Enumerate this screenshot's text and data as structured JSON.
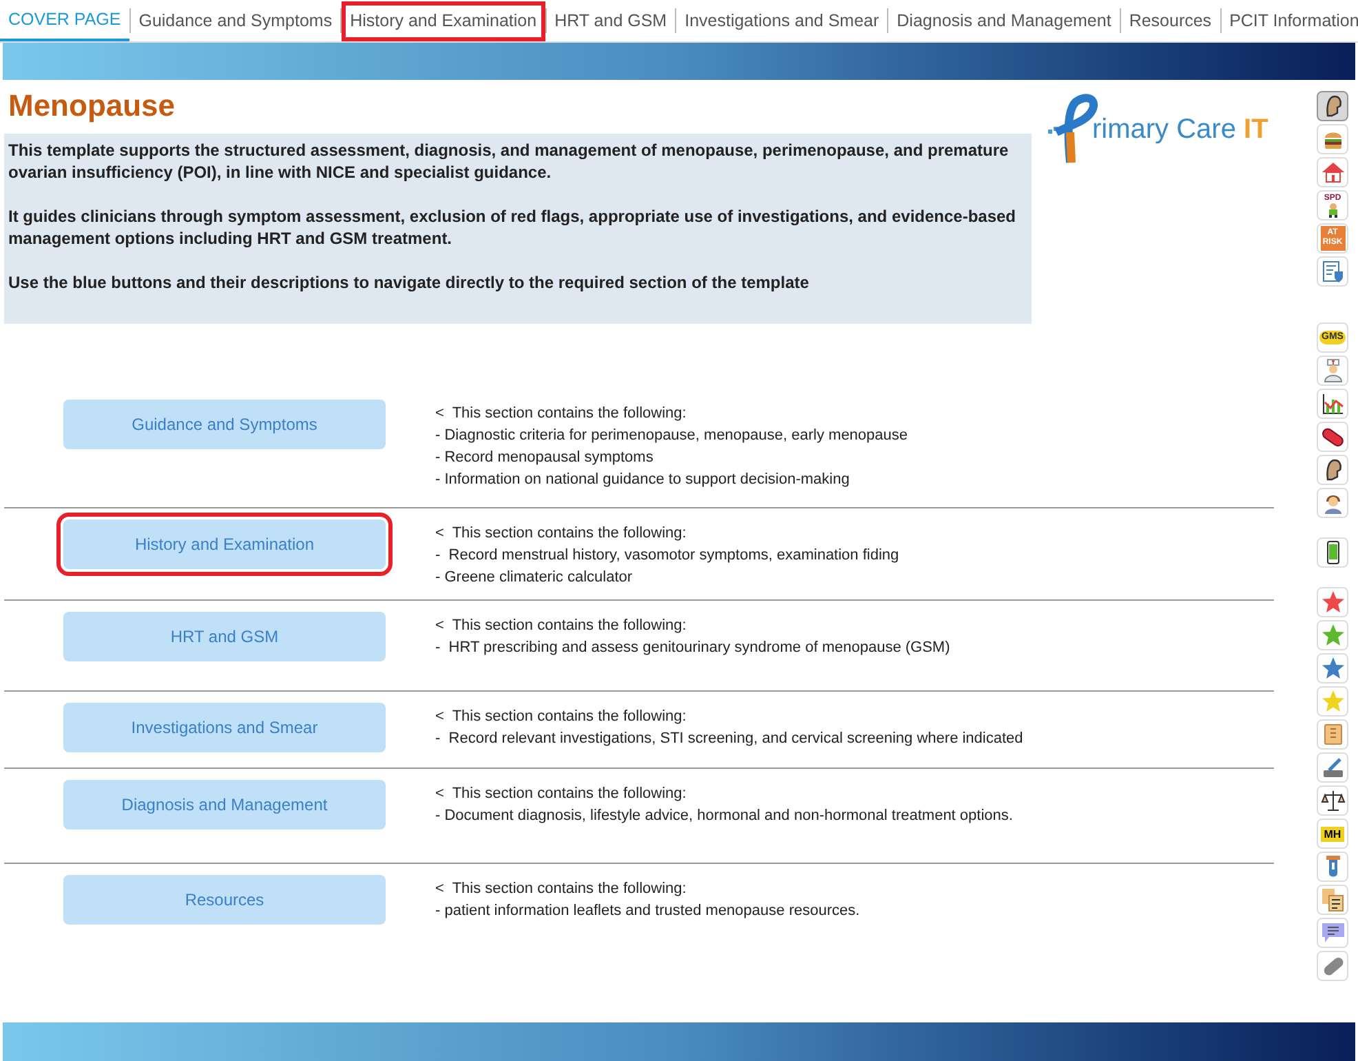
{
  "tabs": [
    {
      "label": "COVER PAGE",
      "selected": true,
      "highlighted": false
    },
    {
      "label": "Guidance and Symptoms",
      "selected": false,
      "highlighted": false
    },
    {
      "label": "History and Examination",
      "selected": false,
      "highlighted": true
    },
    {
      "label": "HRT and GSM",
      "selected": false,
      "highlighted": false
    },
    {
      "label": "Investigations and Smear",
      "selected": false,
      "highlighted": false
    },
    {
      "label": "Diagnosis and Management",
      "selected": false,
      "highlighted": false
    },
    {
      "label": "Resources",
      "selected": false,
      "highlighted": false
    },
    {
      "label": "PCIT Information",
      "selected": false,
      "highlighted": false
    }
  ],
  "title": "Menopause",
  "logo": {
    "text": "rimary Care",
    "accent": "IT"
  },
  "intro": [
    "This template supports the structured assessment, diagnosis, and management of menopause, perimenopause, and premature ovarian insufficiency (POI), in line with NICE and specialist guidance.",
    "It guides clinicians through symptom assessment, exclusion of red flags, appropriate use of investigations, and evidence-based management options including HRT and GSM treatment.",
    "Use the blue buttons and their descriptions to navigate directly to the required section of the template"
  ],
  "sections": [
    {
      "button": "Guidance and Symptoms",
      "highlighted": false,
      "lines": [
        "<  This section contains the following:",
        "- Diagnostic criteria for perimenopause, menopause, early menopause",
        "- Record menopausal symptoms",
        "- Information on national guidance to support decision-making"
      ]
    },
    {
      "button": "History and Examination",
      "highlighted": true,
      "lines": [
        "<  This section contains the following:",
        "-  Record menstrual history, vasomotor symptoms, examination fiding",
        "- Greene climateric calculator"
      ]
    },
    {
      "button": "HRT and GSM",
      "highlighted": false,
      "lines": [
        "<  This section contains the following:",
        "-  HRT prescribing and assess genitourinary syndrome of menopause (GSM)"
      ]
    },
    {
      "button": "Investigations and Smear",
      "highlighted": false,
      "lines": [
        "<  This section contains the following:",
        "-  Record relevant investigations, STI screening, and cervical screening where indicated"
      ]
    },
    {
      "button": "Diagnosis and Management",
      "highlighted": false,
      "lines": [
        "<  This section contains the following:",
        "- Document diagnosis, lifestyle advice, hormonal and non-hormonal treatment options."
      ]
    },
    {
      "button": "Resources",
      "highlighted": false,
      "lines": [
        "<  This section contains the following:",
        "- patient information leaflets and trusted menopause resources."
      ]
    }
  ],
  "toolbar_groups": [
    {
      "buttons": [
        {
          "kind": "head",
          "selected": true
        },
        {
          "kind": "burger",
          "selected": false
        },
        {
          "kind": "house",
          "selected": false
        },
        {
          "kind": "figure",
          "label": "SPD",
          "selected": false
        },
        {
          "kind": "risk",
          "label": "AT RISK",
          "selected": false
        },
        {
          "kind": "document",
          "selected": false
        }
      ]
    },
    {
      "buttons": [
        {
          "kind": "gms",
          "label": "GMS",
          "selected": false
        },
        {
          "kind": "nurse",
          "selected": false
        },
        {
          "kind": "chart",
          "selected": false
        },
        {
          "kind": "pill",
          "selected": false
        },
        {
          "kind": "head",
          "selected": false
        },
        {
          "kind": "person",
          "selected": false
        }
      ]
    },
    {
      "buttons": [
        {
          "kind": "phone",
          "selected": false
        }
      ]
    },
    {
      "buttons": [
        {
          "kind": "star",
          "color": "#f04848",
          "selected": false
        },
        {
          "kind": "star",
          "color": "#5cb82e",
          "selected": false
        },
        {
          "kind": "star",
          "color": "#3f7fc2",
          "selected": false
        },
        {
          "kind": "star",
          "color": "#f2d21b",
          "selected": false
        },
        {
          "kind": "scroll",
          "selected": false
        },
        {
          "kind": "pen",
          "selected": false
        },
        {
          "kind": "scales",
          "selected": false
        },
        {
          "kind": "mh",
          "label": "MH",
          "selected": false
        },
        {
          "kind": "tube",
          "selected": false
        },
        {
          "kind": "documents",
          "selected": false
        },
        {
          "kind": "chat",
          "selected": false
        },
        {
          "kind": "capsule",
          "selected": false
        }
      ]
    }
  ]
}
